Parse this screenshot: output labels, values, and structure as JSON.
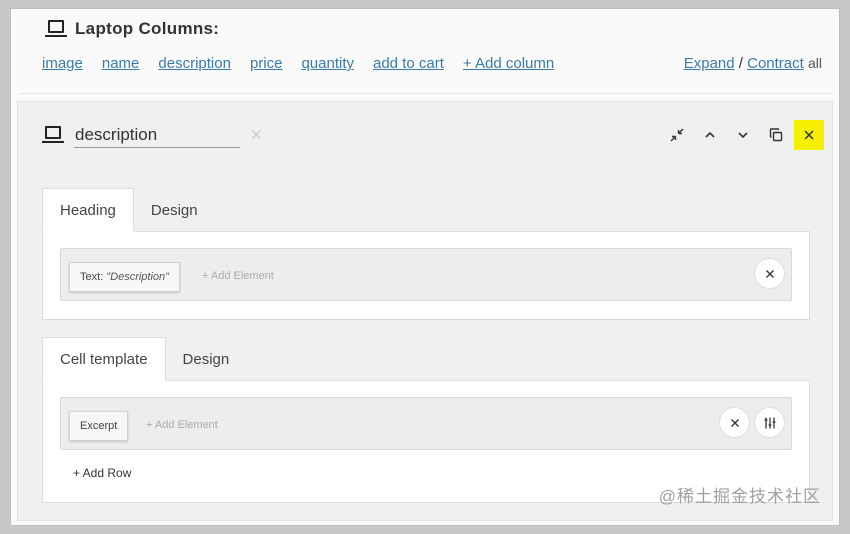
{
  "header": {
    "title": "Laptop Columns:",
    "columns": [
      "image",
      "name",
      "description",
      "price",
      "quantity",
      "add to cart",
      "+ Add column"
    ],
    "expand_label": "Expand",
    "separator": "/",
    "contract_label": "Contract",
    "all_label": "all"
  },
  "column_editor": {
    "name_value": "description",
    "clear_glyph": "✕",
    "icons": [
      "laptop-icon",
      "collapse-icon",
      "chevron-up-icon",
      "chevron-down-icon",
      "duplicate-icon",
      "close-icon"
    ],
    "accent_color": "#f4f000"
  },
  "heading_section": {
    "tabs": [
      "Heading",
      "Design"
    ],
    "active_tab": "Heading",
    "element_prefix": "Text:",
    "element_value": "\"Description\"",
    "add_element_label": "+ Add Element"
  },
  "cell_section": {
    "tabs": [
      "Cell template",
      "Design"
    ],
    "active_tab": "Cell template",
    "element_label": "Excerpt",
    "add_element_label": "+ Add Element",
    "add_row_label": "+ Add Row"
  },
  "watermark": "@稀土掘金技术社区"
}
